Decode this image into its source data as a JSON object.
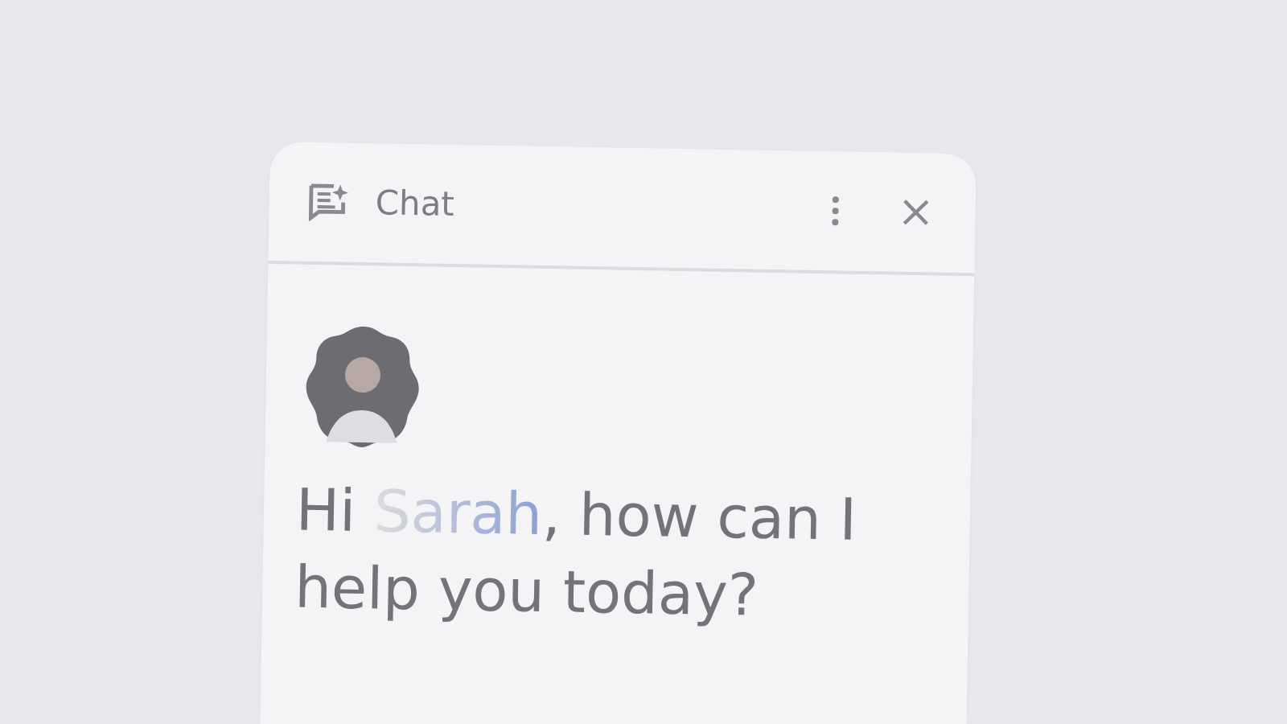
{
  "panel": {
    "title": "Chat"
  },
  "greeting": {
    "before": "Hi ",
    "name": "Sarah",
    "after": ", how can I help you today?"
  }
}
